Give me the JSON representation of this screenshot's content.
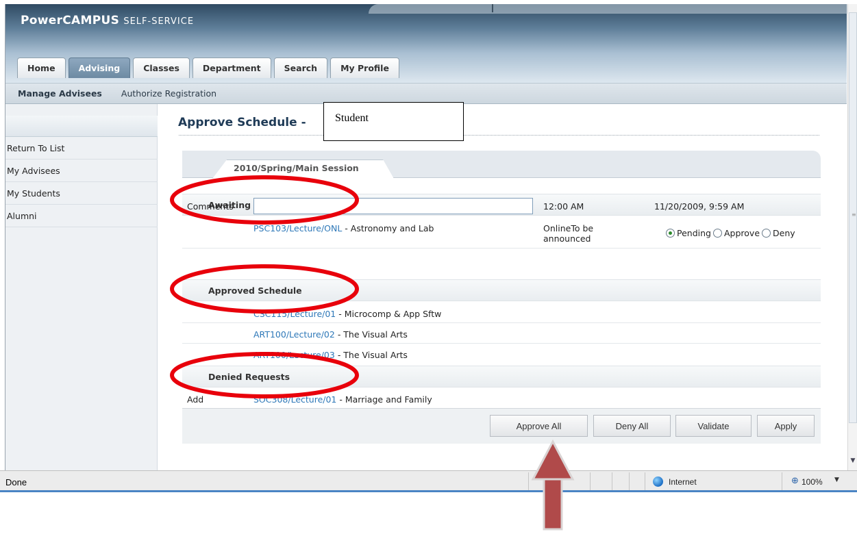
{
  "app": {
    "title_main": "PowerCAMPUS",
    "title_sub": "SELF-SERVICE"
  },
  "tabs": [
    {
      "label": "Home",
      "active": false
    },
    {
      "label": "Advising",
      "active": true
    },
    {
      "label": "Classes",
      "active": false
    },
    {
      "label": "Department",
      "active": false
    },
    {
      "label": "Search",
      "active": false
    },
    {
      "label": "My Profile",
      "active": false
    }
  ],
  "subnav": [
    {
      "label": "Manage Advisees",
      "active": true
    },
    {
      "label": "Authorize Registration",
      "active": false
    }
  ],
  "sidebar": {
    "items": [
      {
        "label": "Return To List"
      },
      {
        "label": "My Advisees"
      },
      {
        "label": "My Students"
      },
      {
        "label": "Alumni"
      }
    ]
  },
  "page": {
    "title": "Approve Schedule -",
    "callout": "Student",
    "term_tab": "2010/Spring/Main Session"
  },
  "awaiting": {
    "heading": "Awaiting Approval",
    "course_code": "PSC103/Lecture/ONL",
    "course_title": " - Astronomy and Lab",
    "location_line1": "OnlineTo be",
    "location_line2": "announced",
    "radio_options": [
      {
        "label": "Pending",
        "checked": true
      },
      {
        "label": "Approve",
        "checked": false
      },
      {
        "label": "Deny",
        "checked": false
      }
    ],
    "comments_label": "Comments",
    "comments_value": "",
    "time": "12:00 AM",
    "submitted": "11/20/2009, 9:59 AM"
  },
  "approved": {
    "heading": "Approved Schedule",
    "courses": [
      {
        "code": "CSC115/Lecture/01",
        "title": " - Microcomp & App Sftw"
      },
      {
        "code": "ART100/Lecture/02",
        "title": " - The Visual Arts"
      },
      {
        "code": "ART100/Lecture/03",
        "title": " - The Visual Arts"
      }
    ]
  },
  "denied": {
    "heading": "Denied Requests",
    "action": "Add",
    "course_code": "SOC308/Lecture/01",
    "course_title": " - Marriage and Family"
  },
  "buttons": {
    "approve_all": "Approve All",
    "deny_all": "Deny All",
    "validate": "Validate",
    "apply": "Apply"
  },
  "statusbar": {
    "status": "Done",
    "zone": "Internet",
    "zoom": "100%"
  },
  "icons": {
    "zone": "globe-icon",
    "zoom": "magnifier-icon",
    "zoom_menu": "chevron-down-icon",
    "scroll_down": "scroll-down-arrow-icon",
    "annotation_arrow": "up-arrow-icon"
  },
  "colors": {
    "link": "#2e78b8",
    "annotation": "#e8000b",
    "annotation_arrow": "#b04a4a",
    "active_tab": "#7a95ad"
  }
}
